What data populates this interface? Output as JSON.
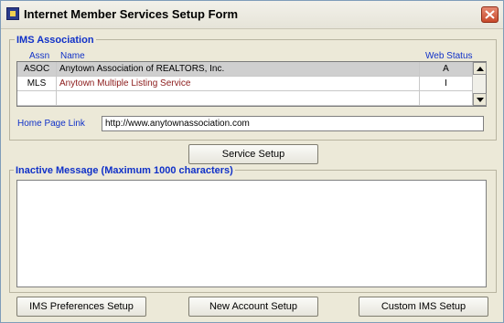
{
  "window": {
    "title": "Internet Member Services Setup Form",
    "close_symbol": "×"
  },
  "ims_association": {
    "label": "IMS Association",
    "columns": {
      "assn": "Assn",
      "name": "Name",
      "web_status": "Web Status"
    },
    "rows": [
      {
        "assn": "ASOC",
        "name": "Anytown Association of REALTORS, Inc.",
        "web_status": "A",
        "selected": true
      },
      {
        "assn": "MLS",
        "name": "Anytown Multiple Listing Service",
        "web_status": "I",
        "selected": false
      }
    ],
    "home_page_label": "Home Page Link",
    "home_page_value": "http://www.anytownassociation.com"
  },
  "buttons": {
    "service_setup": "Service Setup",
    "ims_preferences": "IMS Preferences Setup",
    "new_account": "New Account Setup",
    "custom_ims": "Custom IMS Setup"
  },
  "inactive_message": {
    "label": "Inactive Message (Maximum 1000 characters)",
    "value": ""
  },
  "icons": {
    "app": "app-icon",
    "close": "close-icon",
    "scroll_up": "scroll-up-arrow-icon",
    "scroll_down": "scroll-down-arrow-icon"
  },
  "colors": {
    "label_blue": "#1031c8",
    "row_text_red": "#8b1a1a",
    "window_bg": "#ece9d8",
    "selected_row": "#cfcfcf"
  }
}
